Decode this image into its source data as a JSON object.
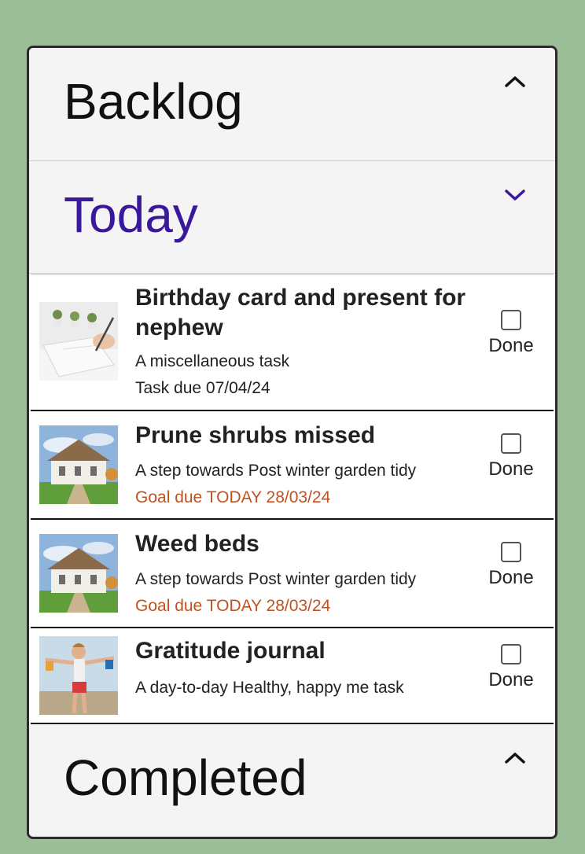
{
  "sections": {
    "backlog": {
      "title": "Backlog",
      "chevron": "chevron-up-icon"
    },
    "today": {
      "title": "Today",
      "chevron": "chevron-down-icon"
    },
    "completed": {
      "title": "Completed",
      "chevron": "chevron-up-icon"
    }
  },
  "tasks": [
    {
      "title": "Birthday card and present for nephew",
      "subtitle": "A miscellaneous task",
      "due": "Task due 07/04/24",
      "done_label": "Done",
      "image": "writing-notebook-image"
    },
    {
      "title": "Prune shrubs missed",
      "subtitle": "A step towards Post winter garden tidy",
      "due": "Goal due TODAY 28/03/24",
      "done_label": "Done",
      "image": "house-garden-image"
    },
    {
      "title": "Weed beds",
      "subtitle": "A step towards Post winter garden tidy",
      "due": "Goal due TODAY 28/03/24",
      "done_label": "Done",
      "image": "house-garden-image"
    },
    {
      "title": "Gratitude journal",
      "subtitle": "A day-to-day Healthy, happy me task",
      "done_label": "Done",
      "image": "happy-person-image"
    }
  ],
  "colors": {
    "background": "#9bbd98",
    "active_section": "#3a189b",
    "goal_due": "#c0521f"
  }
}
